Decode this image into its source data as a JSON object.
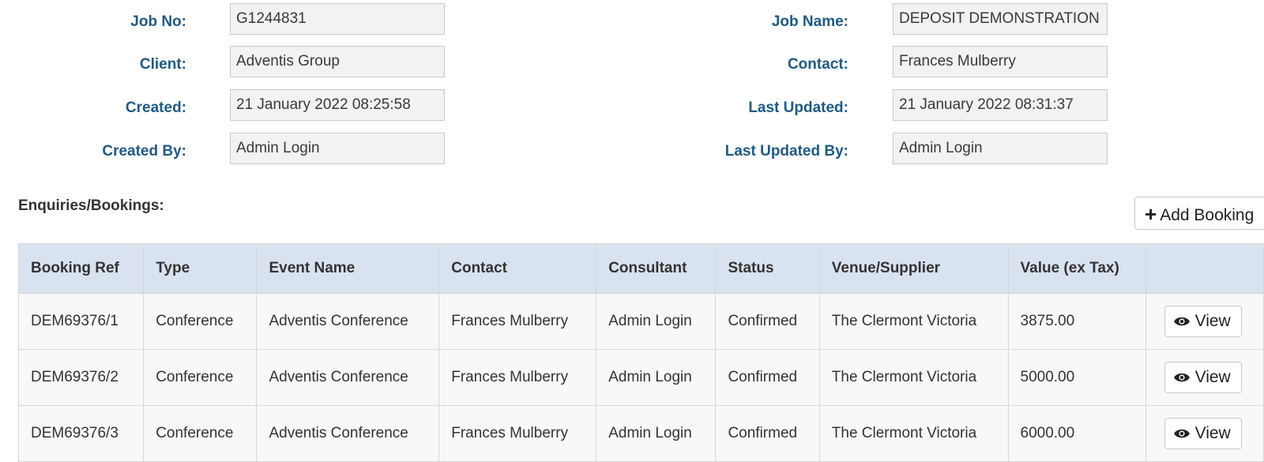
{
  "job": {
    "labels": {
      "job_no": "Job No:",
      "client": "Client:",
      "created": "Created:",
      "created_by": "Created By:",
      "job_name": "Job Name:",
      "contact": "Contact:",
      "last_updated": "Last Updated:",
      "last_updated_by": "Last Updated By:"
    },
    "values": {
      "job_no": "G1244831",
      "client": "Adventis Group",
      "created": "21 January 2022 08:25:58",
      "created_by": "Admin Login",
      "job_name": "DEPOSIT DEMONSTRATION",
      "contact": "Frances Mulberry",
      "last_updated": "21 January 2022 08:31:37",
      "last_updated_by": "Admin Login"
    }
  },
  "bookings": {
    "title": "Enquiries/Bookings:",
    "add_label": "Add Booking",
    "columns": [
      "Booking Ref",
      "Type",
      "Event Name",
      "Contact",
      "Consultant",
      "Status",
      "Venue/Supplier",
      "Value (ex Tax)",
      ""
    ],
    "view_label": "View",
    "rows": [
      [
        "DEM69376/1",
        "Conference",
        "Adventis Conference",
        "Frances Mulberry",
        "Admin Login",
        "Confirmed",
        "The Clermont Victoria",
        "3875.00"
      ],
      [
        "DEM69376/2",
        "Conference",
        "Adventis Conference",
        "Frances Mulberry",
        "Admin Login",
        "Confirmed",
        "The Clermont Victoria",
        "5000.00"
      ],
      [
        "DEM69376/3",
        "Conference",
        "Adventis Conference",
        "Frances Mulberry",
        "Admin Login",
        "Confirmed",
        "The Clermont Victoria",
        "6000.00"
      ]
    ]
  },
  "icons": {
    "add": "plus-icon",
    "view": "eye-icon"
  },
  "colors": {
    "label": "#1f5a85",
    "table_header": "#d9e3f0",
    "input_bg": "#f2f2f2"
  }
}
